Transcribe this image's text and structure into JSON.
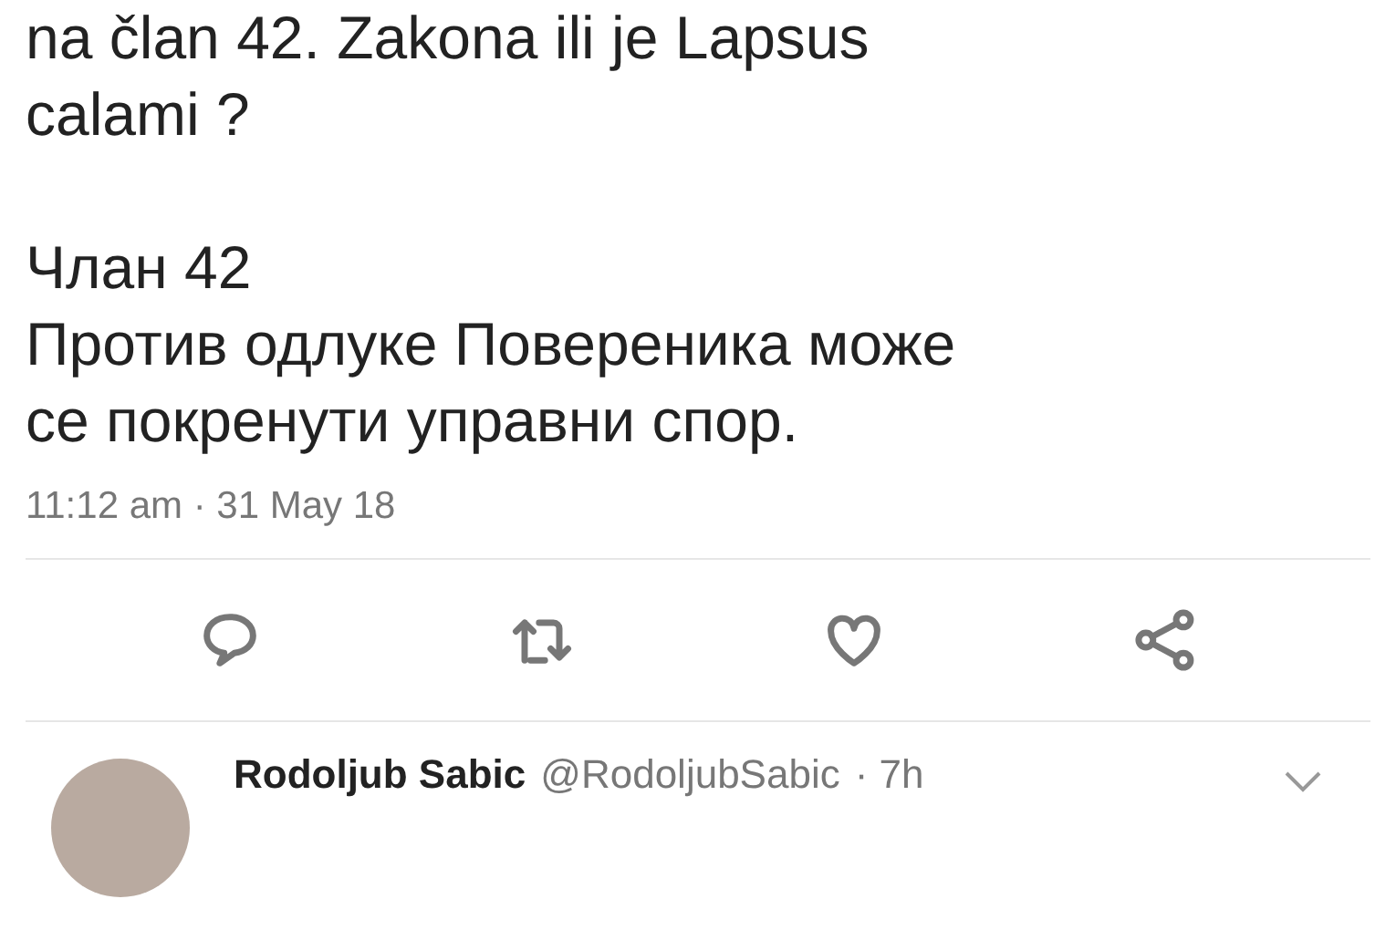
{
  "tweet": {
    "text_lines": [
      "na član 42. Zakona ili je Lapsus",
      "calami ?"
    ],
    "quote_lines": [
      "Члан 42",
      "Против одлуке Повереника може",
      "се покренути управни спор."
    ],
    "timestamp": "11:12 am · 31 May 18"
  },
  "reply": {
    "name": "Rodoljub Sabic",
    "handle": "@RodoljubSabic",
    "time": "· 7h"
  }
}
